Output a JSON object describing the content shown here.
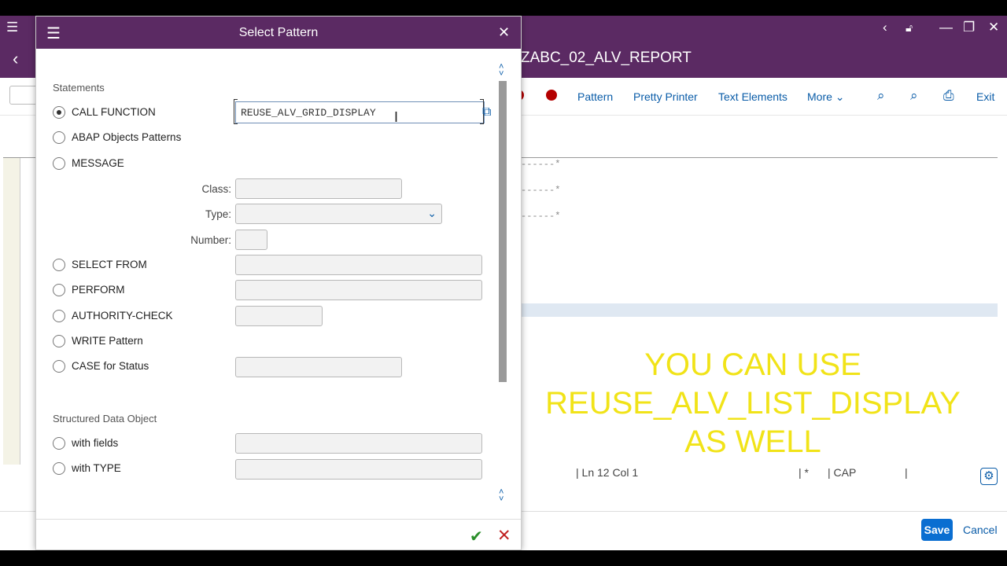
{
  "window": {
    "title": "ZABC_02_ALV_REPORT"
  },
  "toolbar": {
    "pattern": "Pattern",
    "pretty_printer": "Pretty Printer",
    "text_elements": "Text Elements",
    "more": "More",
    "exit": "Exit"
  },
  "editor": {
    "line1": "------*",
    "line2": "------*",
    "line3": "------*",
    "overlay_line1": "YOU CAN USE",
    "overlay_line2": "REUSE_ALV_LIST_DISPLAY",
    "overlay_line3": "AS WELL"
  },
  "status": {
    "ln": "| Ln  12 Col   1",
    "star": "| *",
    "cap": "| CAP",
    "sep": "|"
  },
  "footer": {
    "save": "Save",
    "cancel": "Cancel"
  },
  "dialog": {
    "title": "Select Pattern",
    "statements_heading": "Statements",
    "call_function": "CALL FUNCTION",
    "function_value": "REUSE_ALV_GRID_DISPLAY",
    "abap_objects": "ABAP Objects Patterns",
    "message": "MESSAGE",
    "class_label": "Class:",
    "type_label": "Type:",
    "number_label": "Number:",
    "select_from": "SELECT FROM",
    "perform": "PERFORM",
    "authority_check": "AUTHORITY-CHECK",
    "write_pattern": "WRITE Pattern",
    "case_status": "CASE for Status",
    "structured_heading": "Structured Data Object",
    "with_fields": "with fields",
    "with_type": "with TYPE"
  },
  "colors": {
    "shell": "#5b2a63",
    "link": "#0a5ca8",
    "overlay_text": "#f1e318",
    "save_button": "#0a6ed1"
  }
}
